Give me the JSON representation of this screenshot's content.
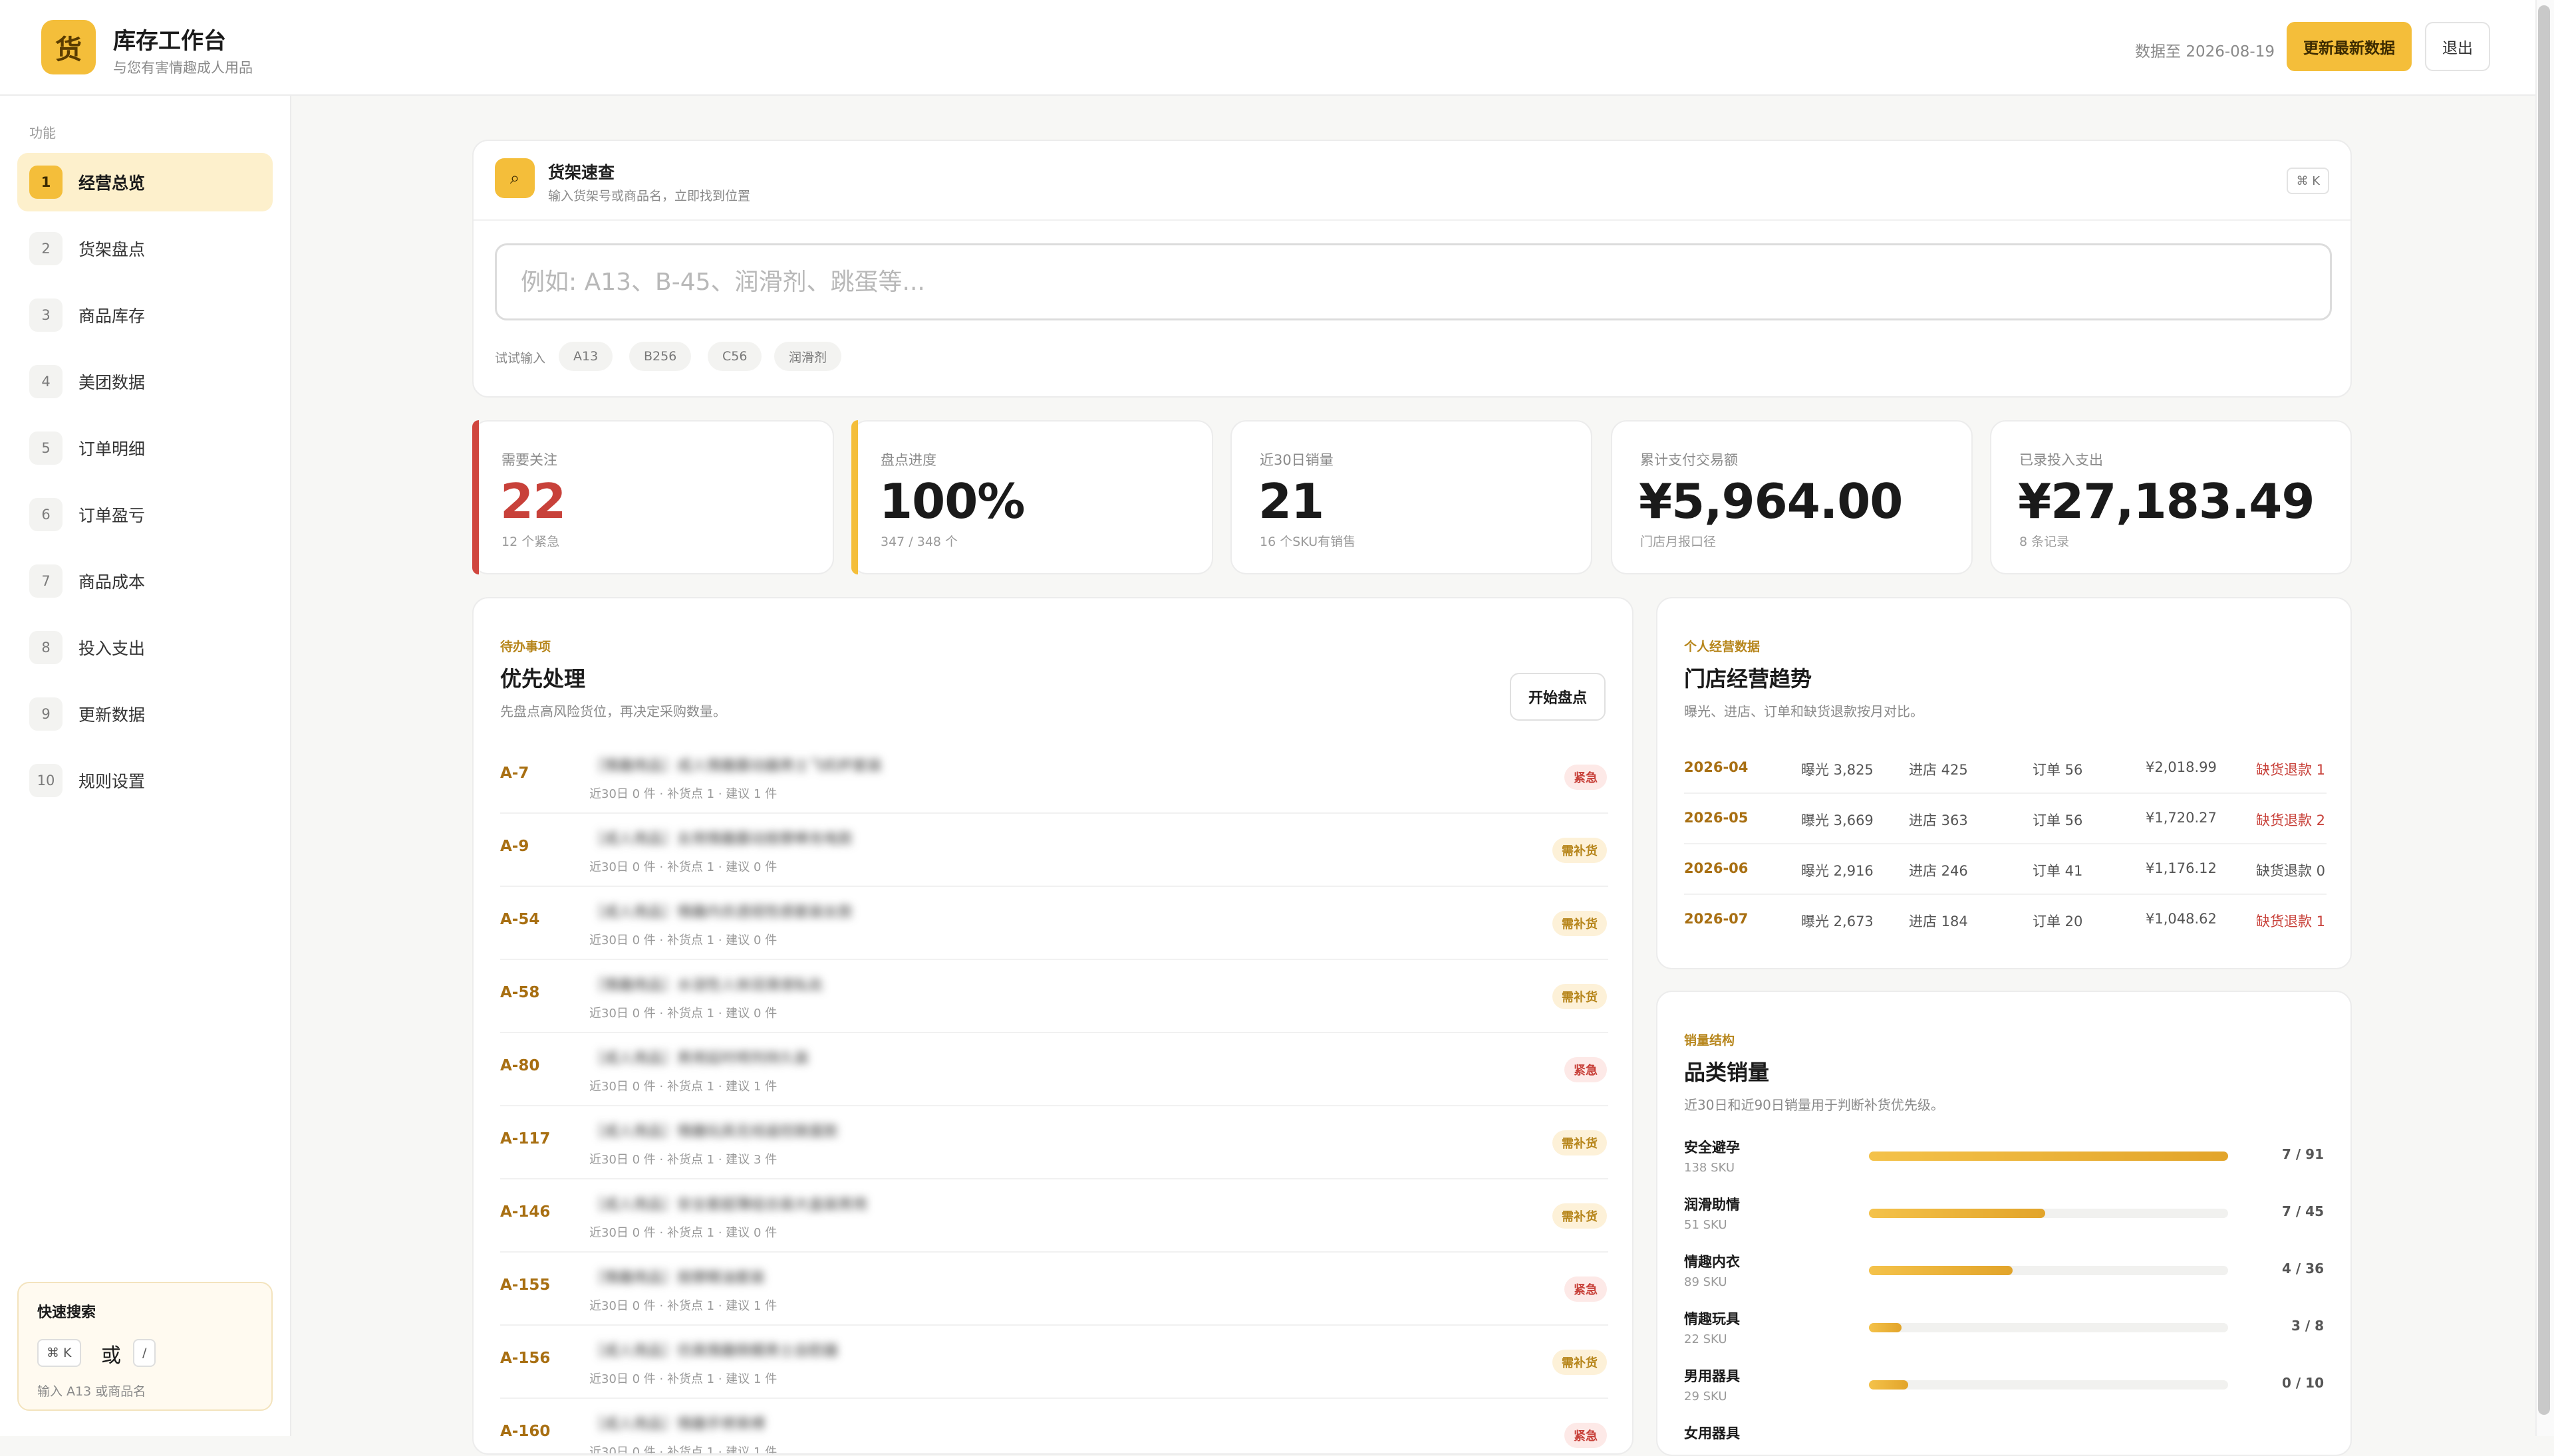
{
  "header": {
    "logo_char": "货",
    "title": "库存工作台",
    "subtitle": "与您有害情趣成人用品",
    "data_date": "数据至 2026-08-19",
    "refresh_label": "更新最新数据",
    "logout_label": "退出"
  },
  "sidebar": {
    "section_label": "功能",
    "items": [
      {
        "num": "1",
        "label": "经营总览",
        "active": true
      },
      {
        "num": "2",
        "label": "货架盘点"
      },
      {
        "num": "3",
        "label": "商品库存"
      },
      {
        "num": "4",
        "label": "美团数据"
      },
      {
        "num": "5",
        "label": "订单明细"
      },
      {
        "num": "6",
        "label": "订单盈亏"
      },
      {
        "num": "7",
        "label": "商品成本"
      },
      {
        "num": "8",
        "label": "投入支出"
      },
      {
        "num": "9",
        "label": "更新数据"
      },
      {
        "num": "10",
        "label": "规则设置"
      }
    ],
    "quick_search": {
      "title": "快速搜索",
      "key1": "⌘ K",
      "or": "或",
      "key2": "/",
      "hint": "输入 A13 或商品名"
    }
  },
  "shelf_search": {
    "icon": "search-icon",
    "title": "货架速查",
    "subtitle": "输入货架号或商品名，立即找到位置",
    "shortcut": "⌘ K",
    "placeholder": "例如: A13、B-45、润滑剂、跳蛋等...",
    "try_label": "试试输入",
    "chips": [
      "A13",
      "B256",
      "C56",
      "润滑剂"
    ]
  },
  "kpis": [
    {
      "label": "需要关注",
      "value": "22",
      "sub": "12 个紧急",
      "accent": "#d0463e",
      "value_color": "red"
    },
    {
      "label": "盘点进度",
      "value": "100%",
      "sub": "347 / 348 个",
      "accent": "#f4be3a"
    },
    {
      "label": "近30日销量",
      "value": "21",
      "sub": "16 个SKU有销售"
    },
    {
      "label": "累计支付交易额",
      "value": "¥5,964.00",
      "sub": "门店月报口径"
    },
    {
      "label": "已录投入支出",
      "value": "¥27,183.49",
      "sub": "8 条记录"
    }
  ],
  "priority": {
    "eyebrow": "待办事项",
    "title": "优先处理",
    "subtitle": "先盘点高风险货位，再决定采购数量。",
    "start_label": "开始盘点",
    "rows": [
      {
        "id": "A-7",
        "name": "［情趣用品］成人情趣震动器男士飞机杯套装",
        "meta": "近30日 0 件 · 补货点 1 · 建议 1 件",
        "badge": "紧急",
        "type": "urgent"
      },
      {
        "id": "A-9",
        "name": "［成人用品］女用情趣震动按摩棒充电款",
        "meta": "近30日 0 件 · 补货点 1 · 建议 0 件",
        "badge": "需补货",
        "type": "restock"
      },
      {
        "id": "A-54",
        "name": "［成人用品］情趣内衣透视性感套装女款",
        "meta": "近30日 0 件 · 补货点 1 · 建议 0 件",
        "badge": "需补货",
        "type": "restock"
      },
      {
        "id": "A-58",
        "name": "［情趣用品］水溶性人体润滑液私处",
        "meta": "近30日 0 件 · 补货点 1 · 建议 0 件",
        "badge": "需补货",
        "type": "restock"
      },
      {
        "id": "A-80",
        "name": "［成人用品］男用延时喷剂持久装",
        "meta": "近30日 0 件 · 补货点 1 · 建议 1 件",
        "badge": "紧急",
        "type": "urgent"
      },
      {
        "id": "A-117",
        "name": "［成人用品］情趣玩具无线遥控跳蛋款",
        "meta": "近30日 0 件 · 补货点 1 · 建议 3 件",
        "badge": "需补货",
        "type": "restock"
      },
      {
        "id": "A-146",
        "name": "［成人用品］安全套超薄组合装大盒装男用",
        "meta": "近30日 0 件 · 补货点 1 · 建议 0 件",
        "badge": "需补货",
        "type": "restock"
      },
      {
        "id": "A-155",
        "name": "［情趣用品］按摩精油套装",
        "meta": "近30日 0 件 · 补货点 1 · 建议 1 件",
        "badge": "紧急",
        "type": "urgent"
      },
      {
        "id": "A-156",
        "name": "［成人用品］仿真情趣倒模男士自慰器",
        "meta": "近30日 0 件 · 补货点 1 · 建议 1 件",
        "badge": "需补货",
        "type": "restock"
      },
      {
        "id": "A-160",
        "name": "［成人用品］情趣手铐束缚",
        "meta": "近30日 0 件 · 补货点 1 · 建议 1 件",
        "badge": "紧急",
        "type": "urgent"
      }
    ]
  },
  "trend": {
    "eyebrow": "个人经营数据",
    "title": "门店经营趋势",
    "subtitle": "曝光、进店、订单和缺货退款按月对比。",
    "rows": [
      {
        "month": "2026-04",
        "exposure": "曝光 3,825",
        "visits": "进店 425",
        "orders": "订单 56",
        "amount": "¥2,018.99",
        "refund": "缺货退款 1",
        "refund_alert": true
      },
      {
        "month": "2026-05",
        "exposure": "曝光 3,669",
        "visits": "进店 363",
        "orders": "订单 56",
        "amount": "¥1,720.27",
        "refund": "缺货退款 2",
        "refund_alert": true
      },
      {
        "month": "2026-06",
        "exposure": "曝光 2,916",
        "visits": "进店 246",
        "orders": "订单 41",
        "amount": "¥1,176.12",
        "refund": "缺货退款 0",
        "refund_alert": false
      },
      {
        "month": "2026-07",
        "exposure": "曝光 2,673",
        "visits": "进店 184",
        "orders": "订单 20",
        "amount": "¥1,048.62",
        "refund": "缺货退款 1",
        "refund_alert": true
      }
    ]
  },
  "categories": {
    "eyebrow": "销量结构",
    "title": "品类销量",
    "subtitle": "近30日和近90日销量用于判断补货优先级。",
    "rows": [
      {
        "name": "安全避孕",
        "sku": "138 SKU",
        "count": "7 / 91",
        "fill": 1.0
      },
      {
        "name": "润滑助情",
        "sku": "51 SKU",
        "count": "7 / 45",
        "fill": 0.49
      },
      {
        "name": "情趣内衣",
        "sku": "89 SKU",
        "count": "4 / 36",
        "fill": 0.4
      },
      {
        "name": "情趣玩具",
        "sku": "22 SKU",
        "count": "3 / 8",
        "fill": 0.09
      },
      {
        "name": "男用器具",
        "sku": "29 SKU",
        "count": "0 / 10",
        "fill": 0.11
      },
      {
        "name": "女用器具",
        "sku": "",
        "count": "",
        "fill": 0
      }
    ]
  }
}
